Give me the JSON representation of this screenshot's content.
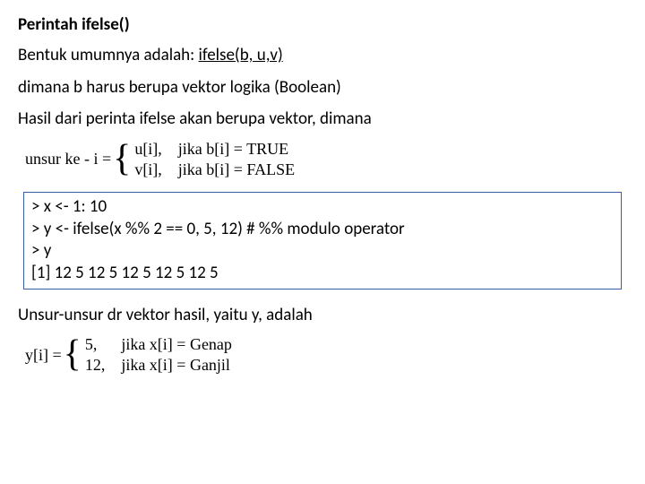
{
  "title": "Perintah ifelse()",
  "p1_a": "Bentuk umumnya adalah: ",
  "p1_b": "ifelse(b, u,v)",
  "p2": "dimana b harus berupa vektor logika (Boolean)",
  "p3": "Hasil dari perinta ifelse akan berupa vektor, dimana",
  "math1": {
    "lhs": "unsur ke - i =",
    "case1": "u[i],    jika b[i] = TRUE",
    "case2": "v[i],    jika b[i] = FALSE"
  },
  "code": {
    "l1": "> x <- 1: 10",
    "l2": "> y <- ifelse(x %% 2 == 0, 5, 12) # %% modulo operator",
    "l3": "> y",
    "l4": "[1] 12 5 12 5 12 5 12 5 12 5"
  },
  "p4": "Unsur-unsur dr vektor hasil, yaitu y, adalah",
  "math2": {
    "lhs": "y[i] =",
    "case1": "5,      jika x[i] = Genap",
    "case2": "12,    jika x[i] = Ganjil"
  }
}
